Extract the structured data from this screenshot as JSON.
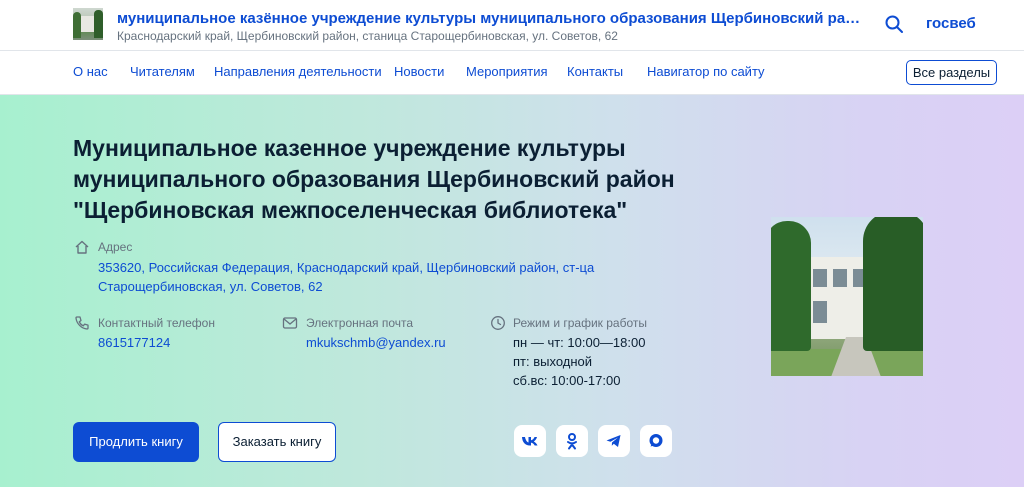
{
  "header": {
    "title": "муниципальное казённое учреждение культуры муниципального образования Щербиновский район \"Щербиновская межпоселенческая библиотека\"",
    "address": "Краснодарский край, Щербиновский район, станица Старощербиновская, ул. Советов, 62",
    "gosweb": "госвеб",
    "icons": {
      "search": "search-icon",
      "logo": "library-building-photo"
    }
  },
  "nav": {
    "items": [
      {
        "label": "О нас"
      },
      {
        "label": "Читателям"
      },
      {
        "label": "Направления деятельности"
      },
      {
        "label": "Новости"
      },
      {
        "label": "Мероприятия"
      },
      {
        "label": "Контакты"
      },
      {
        "label": "Навигатор по сайту"
      }
    ],
    "all_sections": "Все разделы"
  },
  "hero": {
    "title": "Муниципальное казенное учреждение культуры муниципального образования Щербиновский район \"Щербиновская межпоселенческая библиотека\"",
    "address_label": "Адрес",
    "address_line1": "353620, Российская Федерация, Краснодарский край, Щербиновский район, ст-ца",
    "address_line2": "Старощербиновская, ул. Советов, 62",
    "phone_label": "Контактный телефон",
    "phone": "8615177124",
    "email_label": "Электронная почта",
    "email": "mkukschmb@yandex.ru",
    "hours_label": "Режим и график работы",
    "hours": [
      "пн — чт: 10:00—18:00",
      "пт: выходной",
      "сб.вс: 10:00-17:00"
    ],
    "btn_primary": "Продлить книгу",
    "btn_secondary": "Заказать книгу",
    "social_icons": [
      "vk-icon",
      "odnoklassniki-icon",
      "telegram-icon",
      "max-messenger-icon"
    ]
  },
  "colors": {
    "brand_blue": "#0d4cd3",
    "text_dark": "#0b1f33",
    "text_muted": "#66727f",
    "hero_gradient_start": "#a7f0cf",
    "hero_gradient_end": "#dccff6"
  }
}
